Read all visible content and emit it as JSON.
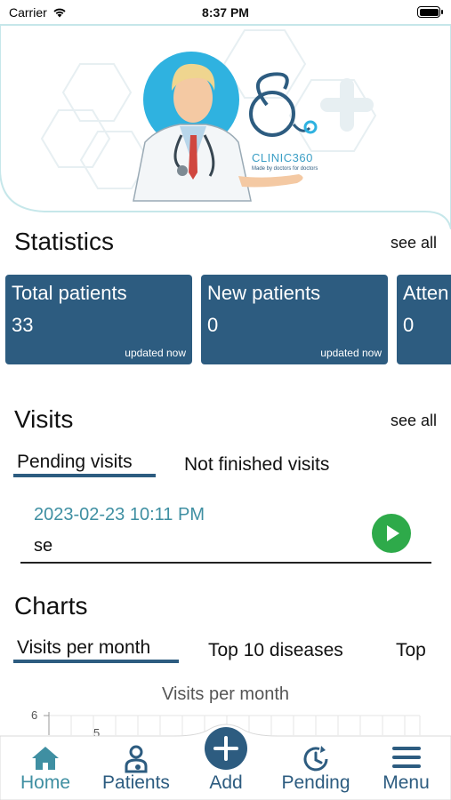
{
  "status_bar": {
    "carrier": "Carrier",
    "time": "8:37 PM"
  },
  "banner": {
    "logo_text": "CLINIC360",
    "logo_tagline": "Made by doctors for doctors"
  },
  "statistics": {
    "title": "Statistics",
    "see_all": "see all",
    "cards": [
      {
        "title": "Total patients",
        "value": "33",
        "updated": "updated now"
      },
      {
        "title": "New patients",
        "value": "0",
        "updated": "updated now"
      },
      {
        "title": "Atten",
        "value": "0",
        "updated": ""
      }
    ]
  },
  "visits": {
    "title": "Visits",
    "see_all": "see all",
    "tabs": [
      {
        "label": "Pending visits",
        "active": true
      },
      {
        "label": "Not finished visits",
        "active": false
      }
    ],
    "items": [
      {
        "date": "2023-02-23 10:11 PM",
        "name": "se"
      }
    ]
  },
  "charts": {
    "title": "Charts",
    "tabs": [
      {
        "label": "Visits per month",
        "active": true
      },
      {
        "label": "Top 10 diseases",
        "active": false
      },
      {
        "label": "Top",
        "active": false
      }
    ]
  },
  "chart_data": {
    "type": "line",
    "title": "Visits per month",
    "y_ticks": [
      "6",
      "5"
    ],
    "x": [],
    "series": []
  },
  "bottom_nav": {
    "items": [
      {
        "label": "Home",
        "icon": "home-icon",
        "active": true
      },
      {
        "label": "Patients",
        "icon": "patient-icon",
        "active": false
      },
      {
        "label": "Add",
        "icon": "plus-icon",
        "active": false
      },
      {
        "label": "Pending",
        "icon": "clock-icon",
        "active": false
      },
      {
        "label": "Menu",
        "icon": "menu-icon",
        "active": false
      }
    ]
  },
  "colors": {
    "primary": "#2d5c80",
    "accent": "#3f8fa2",
    "play": "#2eaa4a",
    "hero_circle": "#2fb2e0"
  }
}
